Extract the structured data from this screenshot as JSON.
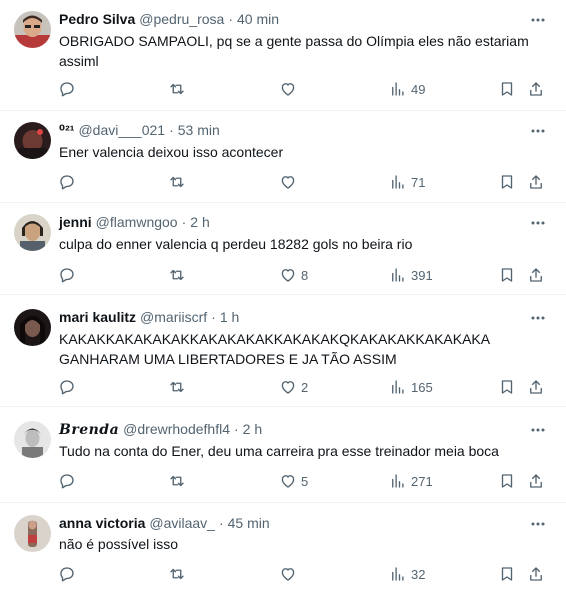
{
  "tweets": [
    {
      "name": "Pedro Silva",
      "handle": "@pedru_rosa",
      "sep": "·",
      "time": "40 min",
      "lines": [
        "OBRIGADO SAMPAOLI, pq se a gente passa do Olímpia eles não estariam",
        "assiml"
      ],
      "retweets": "",
      "likes": "",
      "views": "49",
      "avatar": "pedro-avatar"
    },
    {
      "name": "⁰²¹",
      "handle": "@davi___021",
      "sep": "·",
      "time": "53 min",
      "lines": [
        "Ener valencia deixou isso acontecer"
      ],
      "retweets": "",
      "likes": "",
      "views": "71",
      "avatar": "davi-avatar"
    },
    {
      "name": "jenni",
      "handle": "@flamwngoo",
      "sep": "·",
      "time": "2 h",
      "lines": [
        "culpa do enner valencia q perdeu 18282 gols no beira rio"
      ],
      "retweets": "",
      "likes": "8",
      "views": "391",
      "avatar": "jenni-avatar"
    },
    {
      "name": "mari kaulitz",
      "handle": "@mariiscrf",
      "sep": "·",
      "time": "1 h",
      "lines": [
        "KAKAKKAKAKAKAKKAKAKAKAKKAKAKAKQKAKAKAKKAKAKAKA",
        "GANHARAM UMA LIBERTADORES E JA TÃO ASSIM"
      ],
      "retweets": "",
      "likes": "2",
      "views": "165",
      "avatar": "mari-avatar"
    },
    {
      "name": "𝑩𝒓𝒆𝒏𝒅𝒂",
      "handle": "@drewrhodefhfl4",
      "sep": "·",
      "time": "2 h",
      "lines": [
        "Tudo na conta do Ener, deu uma carreira pra esse treinador meia boca"
      ],
      "retweets": "",
      "likes": "5",
      "views": "271",
      "avatar": "brenda-avatar"
    },
    {
      "name": "anna victoria",
      "handle": "@avilaav_",
      "sep": "·",
      "time": "45 min",
      "lines": [
        "não é possível isso"
      ],
      "retweets": "",
      "likes": "",
      "views": "32",
      "avatar": "anna-avatar"
    }
  ],
  "icons": {
    "more": "more-options-icon",
    "reply": "reply-icon",
    "retweet": "retweet-icon",
    "like": "like-icon",
    "views": "views-icon",
    "bookmark": "bookmark-icon",
    "share": "share-icon"
  },
  "colors": {
    "text": "#0f1419",
    "muted": "#536471",
    "divider": "#eff3f4",
    "background": "#ffffff"
  }
}
